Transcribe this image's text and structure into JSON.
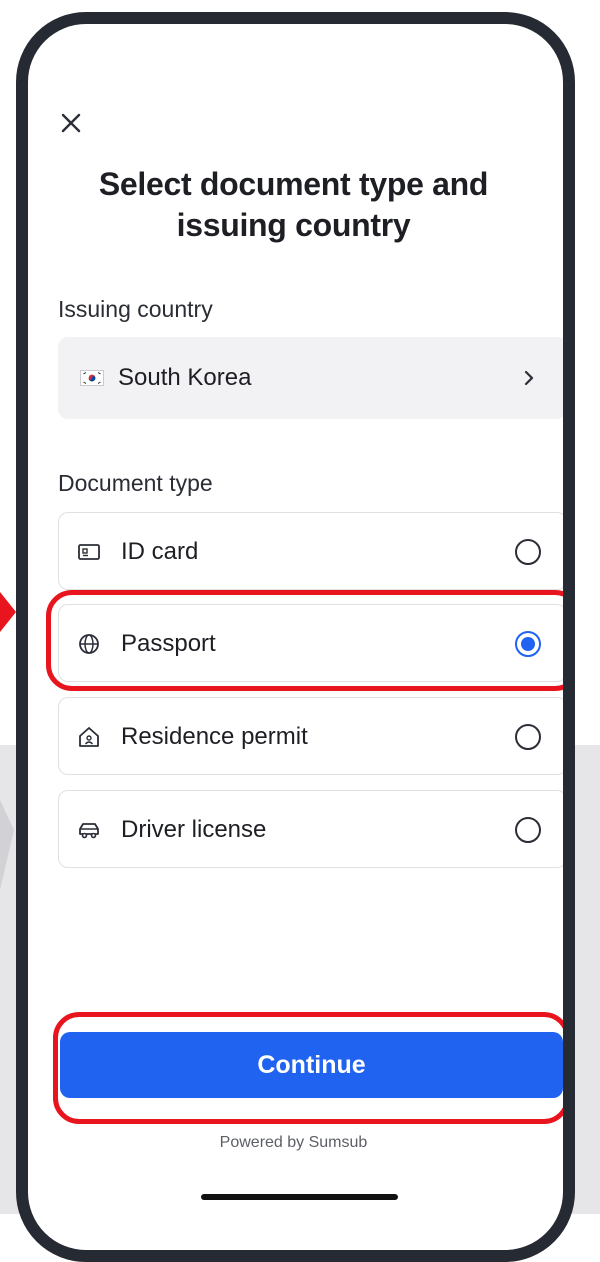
{
  "header": {
    "close_icon": "close-icon",
    "title": "Select document type and issuing country"
  },
  "issuing_country": {
    "label": "Issuing country",
    "selected_country": "South Korea",
    "flag_icon": "south-korea-flag-icon",
    "chevron_icon": "chevron-right-icon"
  },
  "document_type": {
    "label": "Document type",
    "options": [
      {
        "label": "ID card",
        "icon": "id-card-icon",
        "selected": false
      },
      {
        "label": "Passport",
        "icon": "globe-icon",
        "selected": true
      },
      {
        "label": "Residence permit",
        "icon": "house-icon",
        "selected": false
      },
      {
        "label": "Driver license",
        "icon": "car-icon",
        "selected": false
      }
    ]
  },
  "footer": {
    "continue_label": "Continue",
    "powered_by": "Powered by Sumsub"
  },
  "colors": {
    "accent": "#1f63f0",
    "highlight": "#e8141e",
    "phone_frame": "#262a33"
  }
}
